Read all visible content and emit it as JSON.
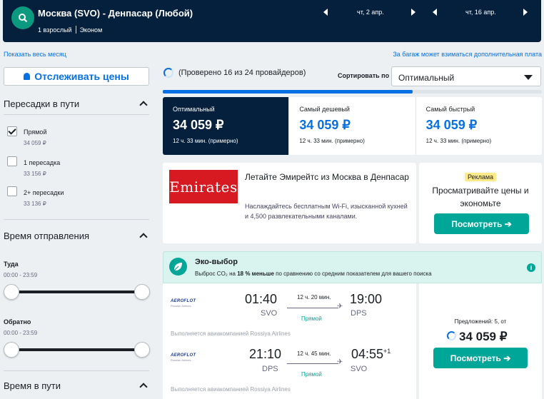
{
  "header": {
    "route": "Москва (SVO) - Денпасар (Любой)",
    "passengers": "1 взрослый",
    "cabin": "Эконом",
    "depart_date": "чт, 2 апр.",
    "return_date": "чт, 16 апр."
  },
  "links": {
    "show_month": "Показать весь месяц",
    "baggage": "За багаж может взиматься дополнительная плата"
  },
  "sidebar": {
    "track_prices": "Отслеживать цены",
    "stops_title": "Пересадки в пути",
    "stops": [
      {
        "label": "Прямой",
        "price": "34 059 ₽",
        "checked": true
      },
      {
        "label": "1 пересадка",
        "price": "33 156 ₽",
        "checked": false
      },
      {
        "label": "2+ пересадки",
        "price": "33 136 ₽",
        "checked": false
      }
    ],
    "departure_title": "Время отправления",
    "outbound_label": "Туда",
    "outbound_range": "00:00 - 23:59",
    "return_label": "Обратно",
    "return_range": "00:00 - 23:59",
    "duration_title": "Время в пути"
  },
  "main": {
    "checked_status": "(Проверено 16 из 24 провайдеров)",
    "sort_label": "Сортировать по",
    "sort_value": "Оптимальный",
    "progress": 0.66,
    "tabs": [
      {
        "label": "Оптимальный",
        "price": "34 059 ₽",
        "time": "12 ч. 33 мин. (примерно)"
      },
      {
        "label": "Самый дешевый",
        "price": "34 059 ₽",
        "time": "12 ч. 33 мин. (примерно)"
      },
      {
        "label": "Самый быстрый",
        "price": "34 059 ₽",
        "time": "12 ч. 33 мин. (примерно)"
      }
    ]
  },
  "ad": {
    "logo": "Emirates",
    "headline": "Летайте Эмирейтс из Москва в Денпасар",
    "body": "Наслаждайтесь бесплатным Wi-Fi, изысканной кухней и 4,500 развлекательными каналами.",
    "badge": "Реклама",
    "side_text": "Просматривайте цены и экономьте",
    "button": "Посмотреть ➔"
  },
  "eco": {
    "title": "Эко-выбор",
    "desc_pre": "Выброс CO₂ на ",
    "desc_bold": "18 % меньше",
    "desc_post": " по сравнению со средним показателем для вашего поиска"
  },
  "result": {
    "airline_logo": "AEROFLOT",
    "airline_logo_sub": "Russian Airlines",
    "outbound": {
      "dep_time": "01:40",
      "dep_apt": "SVO",
      "arr_time": "19:00",
      "arr_apt": "DPS",
      "duration": "12 ч. 20 мин.",
      "stops": "Прямой"
    },
    "inbound": {
      "dep_time": "21:10",
      "dep_apt": "DPS",
      "arr_time": "04:55",
      "arr_plus": "+1",
      "arr_apt": "SVO",
      "duration": "12 ч. 45 мин.",
      "stops": "Прямой"
    },
    "operated_by": "Выполняется авиакомпанией Rossiya Airlines",
    "offers": "Предложений: 5, от",
    "price": "34 059 ₽",
    "button": "Посмотреть ➔"
  },
  "colors": {
    "navy": "#05203c",
    "blue": "#0770e3",
    "green": "#00a698",
    "eco_bg": "#d9f3ee"
  }
}
